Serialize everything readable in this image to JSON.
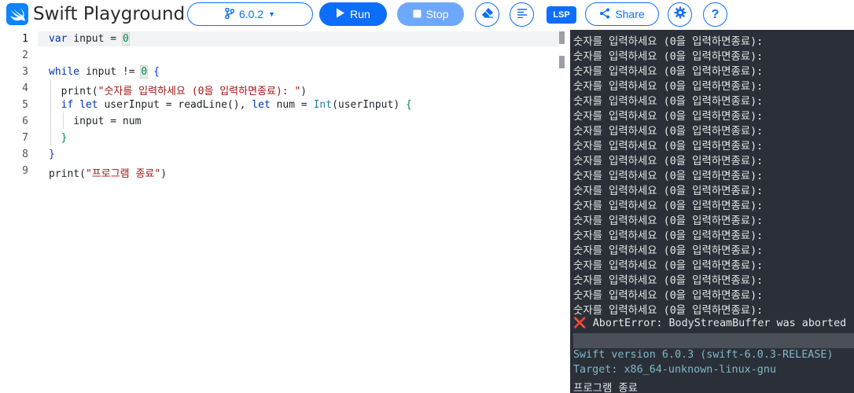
{
  "header": {
    "title": "Swift Playground",
    "version": "6.0.2",
    "run_label": "Run",
    "stop_label": "Stop",
    "lsp_label": "LSP",
    "share_label": "Share"
  },
  "editor": {
    "line_numbers": [
      "1",
      "2",
      "3",
      "4",
      "5",
      "6",
      "7",
      "8",
      "9"
    ]
  },
  "console": {
    "prompt_line": "숫자를 입력하세요 (0을 입력하면종료):",
    "prompt_repeat": 19,
    "error_text": "AbortError: BodyStreamBuffer was aborted",
    "version_line": "Swift version 6.0.3 (swift-6.0.3-RELEASE)",
    "target_line": "Target: x86_64-unknown-linux-gnu",
    "final_line": "프로그램 종료"
  },
  "colors": {
    "accent": "#0d6efd",
    "console_bg": "#2b3038",
    "error": "#e53935"
  }
}
